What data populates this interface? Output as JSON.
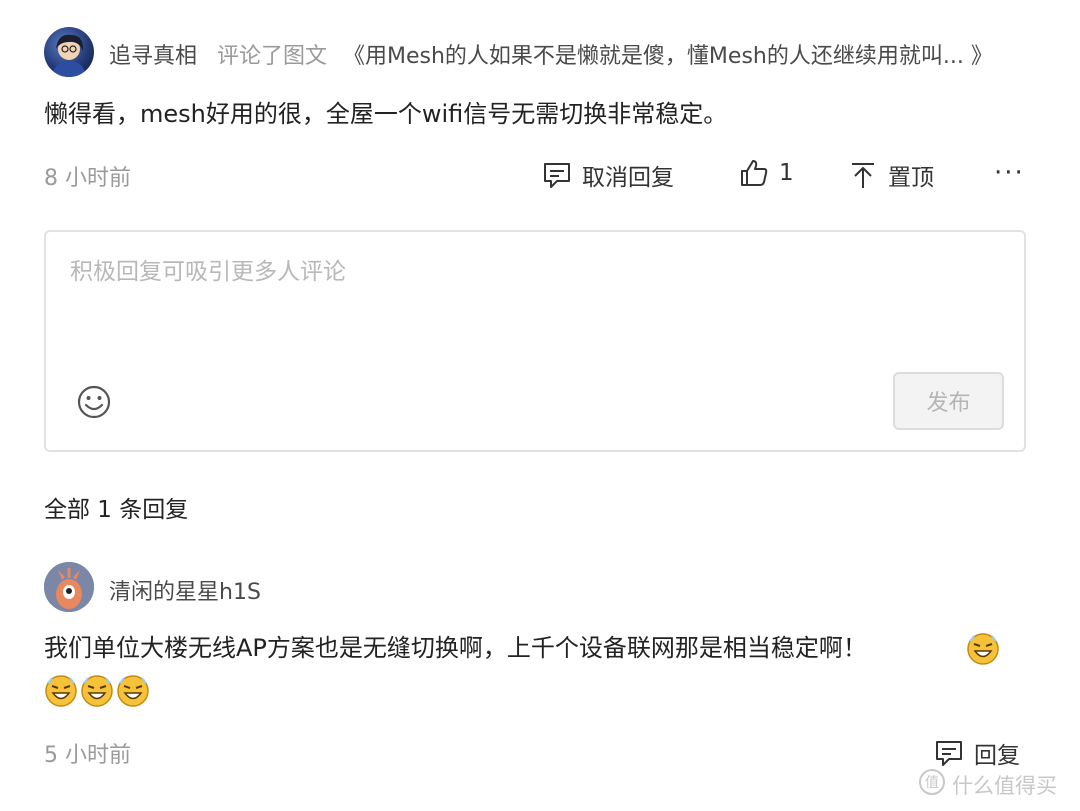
{
  "comment": {
    "author": "追寻真相",
    "action": "评论了图文",
    "article_title": "《用Mesh的人如果不是懒就是傻，懂Mesh的人还继续用就叫... 》",
    "text": "懒得看，mesh好用的很，全屋一个wifi信号无需切换非常稳定。",
    "time": "8 小时前",
    "actions": {
      "cancel_reply_label": "取消回复",
      "like_count": "1",
      "pin_label": "置顶",
      "more_label": "···"
    }
  },
  "reply_box": {
    "placeholder": "积极回复可吸引更多人评论",
    "publish_label": "发布"
  },
  "replies_header": "全部 1 条回复",
  "reply": {
    "author": "清闲的星星h1S",
    "text_line1": "我们单位大楼无线AP方案也是无缝切换啊，上千个设备联网那是相当稳定啊！",
    "time": "5 小时前",
    "reply_label": "回复",
    "emoji_count": 4
  },
  "watermark": "什么值得买",
  "colors": {
    "text_primary": "#222222",
    "text_secondary": "#9a9a9a",
    "border": "#e2e2e2"
  }
}
